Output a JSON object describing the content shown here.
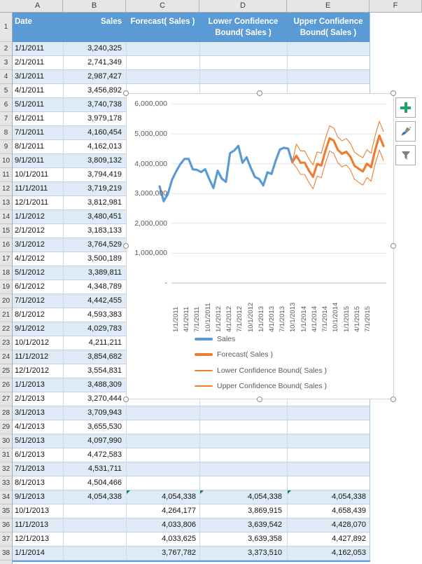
{
  "sheet": {
    "col_letters": [
      "A",
      "B",
      "C",
      "D",
      "E",
      "F"
    ],
    "headers": {
      "date": "Date",
      "sales": "Sales",
      "forecast": "Forecast( Sales )",
      "lower": "Lower Confidence Bound( Sales )",
      "upper": "Upper Confidence Bound( Sales )"
    },
    "visible_row_numbers": "1-38",
    "rows": [
      {
        "n": 2,
        "date": "1/1/2011",
        "sales": "3,240,325",
        "forecast": "",
        "lower": "",
        "upper": "",
        "flag": false
      },
      {
        "n": 3,
        "date": "2/1/2011",
        "sales": "2,741,349",
        "forecast": "",
        "lower": "",
        "upper": "",
        "flag": false
      },
      {
        "n": 4,
        "date": "3/1/2011",
        "sales": "2,987,427",
        "forecast": "",
        "lower": "",
        "upper": "",
        "flag": false
      },
      {
        "n": 5,
        "date": "4/1/2011",
        "sales": "3,456,892",
        "forecast": "",
        "lower": "",
        "upper": "",
        "flag": false
      },
      {
        "n": 6,
        "date": "5/1/2011",
        "sales": "3,740,738",
        "forecast": "",
        "lower": "",
        "upper": "",
        "flag": false
      },
      {
        "n": 7,
        "date": "6/1/2011",
        "sales": "3,979,178",
        "forecast": "",
        "lower": "",
        "upper": "",
        "flag": false
      },
      {
        "n": 8,
        "date": "7/1/2011",
        "sales": "4,160,454",
        "forecast": "",
        "lower": "",
        "upper": "",
        "flag": false
      },
      {
        "n": 9,
        "date": "8/1/2011",
        "sales": "4,162,013",
        "forecast": "",
        "lower": "",
        "upper": "",
        "flag": false
      },
      {
        "n": 10,
        "date": "9/1/2011",
        "sales": "3,809,132",
        "forecast": "",
        "lower": "",
        "upper": "",
        "flag": false
      },
      {
        "n": 11,
        "date": "10/1/2011",
        "sales": "3,794,419",
        "forecast": "",
        "lower": "",
        "upper": "",
        "flag": false
      },
      {
        "n": 12,
        "date": "11/1/2011",
        "sales": "3,719,219",
        "forecast": "",
        "lower": "",
        "upper": "",
        "flag": false
      },
      {
        "n": 13,
        "date": "12/1/2011",
        "sales": "3,812,981",
        "forecast": "",
        "lower": "",
        "upper": "",
        "flag": false
      },
      {
        "n": 14,
        "date": "1/1/2012",
        "sales": "3,480,451",
        "forecast": "",
        "lower": "",
        "upper": "",
        "flag": false
      },
      {
        "n": 15,
        "date": "2/1/2012",
        "sales": "3,183,133",
        "forecast": "",
        "lower": "",
        "upper": "",
        "flag": false
      },
      {
        "n": 16,
        "date": "3/1/2012",
        "sales": "3,764,529",
        "forecast": "",
        "lower": "",
        "upper": "",
        "flag": false
      },
      {
        "n": 17,
        "date": "4/1/2012",
        "sales": "3,500,189",
        "forecast": "",
        "lower": "",
        "upper": "",
        "flag": false
      },
      {
        "n": 18,
        "date": "5/1/2012",
        "sales": "3,389,811",
        "forecast": "",
        "lower": "",
        "upper": "",
        "flag": false
      },
      {
        "n": 19,
        "date": "6/1/2012",
        "sales": "4,348,789",
        "forecast": "",
        "lower": "",
        "upper": "",
        "flag": false
      },
      {
        "n": 20,
        "date": "7/1/2012",
        "sales": "4,442,455",
        "forecast": "",
        "lower": "",
        "upper": "",
        "flag": false
      },
      {
        "n": 21,
        "date": "8/1/2012",
        "sales": "4,593,383",
        "forecast": "",
        "lower": "",
        "upper": "",
        "flag": false
      },
      {
        "n": 22,
        "date": "9/1/2012",
        "sales": "4,029,783",
        "forecast": "",
        "lower": "",
        "upper": "",
        "flag": false
      },
      {
        "n": 23,
        "date": "10/1/2012",
        "sales": "4,211,211",
        "forecast": "",
        "lower": "",
        "upper": "",
        "flag": false
      },
      {
        "n": 24,
        "date": "11/1/2012",
        "sales": "3,854,682",
        "forecast": "",
        "lower": "",
        "upper": "",
        "flag": false
      },
      {
        "n": 25,
        "date": "12/1/2012",
        "sales": "3,554,831",
        "forecast": "",
        "lower": "",
        "upper": "",
        "flag": false
      },
      {
        "n": 26,
        "date": "1/1/2013",
        "sales": "3,488,309",
        "forecast": "",
        "lower": "",
        "upper": "",
        "flag": false
      },
      {
        "n": 27,
        "date": "2/1/2013",
        "sales": "3,270,444",
        "forecast": "",
        "lower": "",
        "upper": "",
        "flag": false
      },
      {
        "n": 28,
        "date": "3/1/2013",
        "sales": "3,709,943",
        "forecast": "",
        "lower": "",
        "upper": "",
        "flag": false
      },
      {
        "n": 29,
        "date": "4/1/2013",
        "sales": "3,655,530",
        "forecast": "",
        "lower": "",
        "upper": "",
        "flag": false
      },
      {
        "n": 30,
        "date": "5/1/2013",
        "sales": "4,097,990",
        "forecast": "",
        "lower": "",
        "upper": "",
        "flag": false
      },
      {
        "n": 31,
        "date": "6/1/2013",
        "sales": "4,472,583",
        "forecast": "",
        "lower": "",
        "upper": "",
        "flag": false
      },
      {
        "n": 32,
        "date": "7/1/2013",
        "sales": "4,531,711",
        "forecast": "",
        "lower": "",
        "upper": "",
        "flag": false
      },
      {
        "n": 33,
        "date": "8/1/2013",
        "sales": "4,504,466",
        "forecast": "",
        "lower": "",
        "upper": "",
        "flag": false
      },
      {
        "n": 34,
        "date": "9/1/2013",
        "sales": "4,054,338",
        "forecast": "4,054,338",
        "lower": "4,054,338",
        "upper": "4,054,338",
        "flag": true
      },
      {
        "n": 35,
        "date": "10/1/2013",
        "sales": "",
        "forecast": "4,264,177",
        "lower": "3,869,915",
        "upper": "4,658,439",
        "flag": false
      },
      {
        "n": 36,
        "date": "11/1/2013",
        "sales": "",
        "forecast": "4,033,806",
        "lower": "3,639,542",
        "upper": "4,428,070",
        "flag": false
      },
      {
        "n": 37,
        "date": "12/1/2013",
        "sales": "",
        "forecast": "4,033,625",
        "lower": "3,639,358",
        "upper": "4,427,892",
        "flag": false
      },
      {
        "n": 38,
        "date": "1/1/2014",
        "sales": "",
        "forecast": "3,767,782",
        "lower": "3,373,510",
        "upper": "4,162,053",
        "flag": false
      }
    ]
  },
  "chart_data": {
    "type": "line",
    "title": "",
    "xlabel": "",
    "ylabel": "",
    "ylim": [
      0,
      6000000
    ],
    "grid": true,
    "legend_position": "bottom-left",
    "y_tick_labels": [
      "6,000,000",
      "5,000,000",
      "4,000,000",
      "3,000,000",
      "2,000,000",
      "1,000,000",
      "-"
    ],
    "x_tick_labels": [
      "1/1/2011",
      "4/1/2011",
      "7/1/2011",
      "10/1/2011",
      "1/1/2012",
      "4/1/2012",
      "7/1/2012",
      "10/1/2012",
      "1/1/2013",
      "4/1/2013",
      "7/1/2013",
      "10/1/2013",
      "1/1/2014",
      "4/1/2014",
      "7/1/2014",
      "10/1/2014",
      "1/1/2015",
      "4/1/2015",
      "7/1/2015"
    ],
    "x_is_monthly_from": "1/1/2011",
    "x_point_count": 55,
    "forecast_start_index": 32,
    "series": [
      {
        "name": "Sales",
        "color": "#5B9BD5",
        "weight": "thick",
        "values": [
          3240325,
          2741349,
          2987427,
          3456892,
          3740738,
          3979178,
          4160454,
          4162013,
          3809132,
          3794419,
          3719219,
          3812981,
          3480451,
          3183133,
          3764529,
          3500189,
          3389811,
          4348789,
          4442455,
          4593383,
          4029783,
          4211211,
          3854682,
          3554831,
          3488309,
          3270444,
          3709943,
          3655530,
          4097990,
          4472583,
          4531711,
          4504466,
          4054338
        ]
      },
      {
        "name": "Forecast( Sales )",
        "color": "#ED7D31",
        "weight": "thick",
        "values": [
          4054338,
          4264177,
          4033806,
          4033625,
          3767782,
          3560000,
          3990000,
          3940000,
          4430000,
          4850000,
          4770000,
          4460000,
          4330000,
          4400000,
          4240000,
          3930000,
          3830000,
          3740000,
          4000000,
          3880000,
          4470000,
          4940000,
          4590000
        ]
      },
      {
        "name": "Lower Confidence Bound( Sales )",
        "color": "#ED7D31",
        "weight": "thin",
        "values": [
          4054338,
          3869915,
          3639542,
          3639358,
          3373510,
          3160000,
          3585000,
          3530000,
          4015000,
          4430000,
          4345000,
          4030000,
          3895000,
          3960000,
          3795000,
          3480000,
          3375000,
          3280000,
          3535000,
          3410000,
          3995000,
          4460000,
          4105000
        ]
      },
      {
        "name": "Upper Confidence Bound( Sales )",
        "color": "#ED7D31",
        "weight": "thin",
        "values": [
          4054338,
          4658439,
          4428070,
          4427892,
          4162053,
          3960000,
          4395000,
          4350000,
          4845000,
          5270000,
          5195000,
          4890000,
          4765000,
          4840000,
          4685000,
          4380000,
          4285000,
          4200000,
          4465000,
          4350000,
          4945000,
          5420000,
          5075000
        ]
      }
    ],
    "legend": [
      "Sales",
      "Forecast( Sales )",
      "Lower Confidence Bound( Sales )",
      "Upper Confidence Bound( Sales )"
    ]
  },
  "chart_tools": [
    {
      "name": "chart-elements",
      "icon": "plus-icon"
    },
    {
      "name": "chart-styles",
      "icon": "paintbrush-icon"
    },
    {
      "name": "chart-filters",
      "icon": "funnel-icon"
    }
  ],
  "colors": {
    "table_header_bg": "#5B9BD5",
    "table_band_bg": "#DEEBF6",
    "sales_line": "#5B9BD5",
    "forecast_line": "#ED7D31",
    "flag_green": "#1E8245",
    "plus_green": "#21A366",
    "axis_text": "#595959",
    "gridline": "#E3E3E3"
  }
}
